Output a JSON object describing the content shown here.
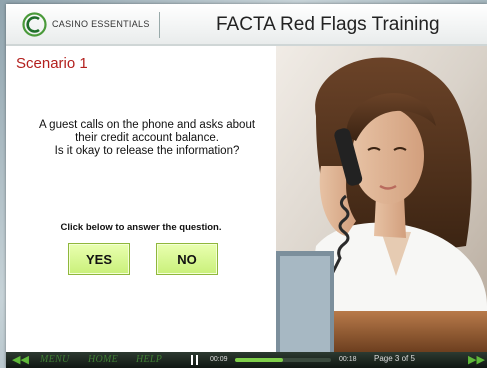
{
  "header": {
    "brand": "CASINO ESSENTIALS",
    "course_title": "FACTA Red Flags Training"
  },
  "scenario": {
    "title": "Scenario 1",
    "question_line1": "A guest calls on the phone and asks about",
    "question_line2": "their credit account balance.",
    "question_line3": "Is it okay to release the information?",
    "instruction": "Click below to answer the question.",
    "yes_label": "YES",
    "no_label": "NO"
  },
  "footer": {
    "menu_label": "MENU",
    "home_label": "HOME",
    "help_label": "HELP",
    "elapsed": "00:09",
    "duration": "00:18",
    "progress": 0.5,
    "page_counter": "Page 3 of 5"
  },
  "colors": {
    "accent_red": "#b3201e",
    "button_green": "#c9f07a",
    "nav_green": "#5fb93a"
  }
}
